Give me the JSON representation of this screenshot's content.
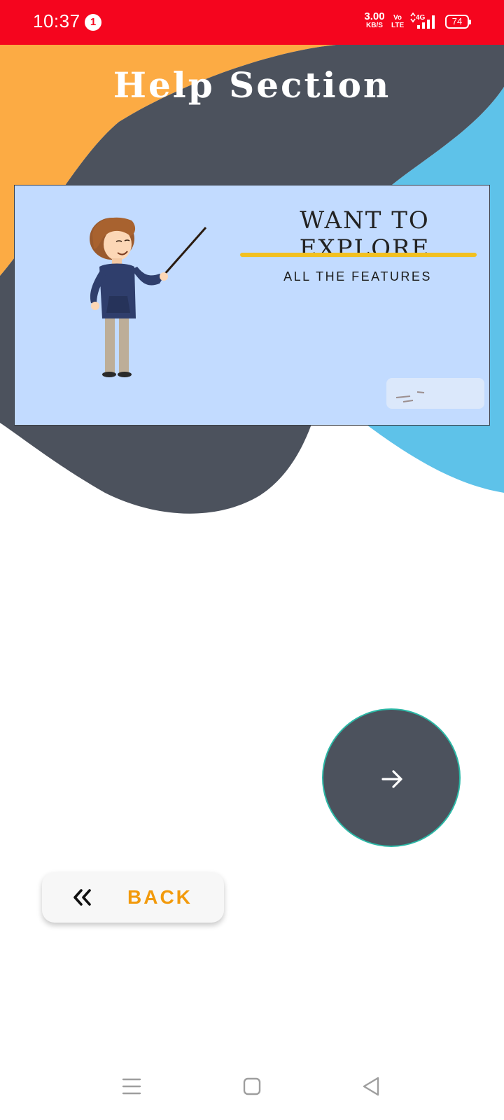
{
  "status_bar": {
    "time": "10:37",
    "notification_count": "1",
    "net_speed_value": "3.00",
    "net_speed_unit": "KB/S",
    "volte_top": "Vo",
    "volte_bottom": "LTE",
    "network_type": "4G",
    "battery_level": "74",
    "background_color": "#f5051e"
  },
  "header": {
    "title": "Help Section"
  },
  "banner": {
    "heading": "WANT TO EXPLORE",
    "subheading": "ALL THE FEATURES",
    "background_color": "#c2dbff",
    "underline_color": "#f2c021"
  },
  "next_button": {
    "icon": "arrow-right-icon",
    "color": "#4c525d"
  },
  "back_button": {
    "icon": "double-chevron-left-icon",
    "label": "BACK",
    "label_color": "#f29a0c"
  },
  "nav_bar": {
    "items": [
      "menu-icon",
      "home-square-icon",
      "back-triangle-icon"
    ]
  },
  "theme": {
    "orange_blob": "#fcab44",
    "dark_blob": "#4c525d",
    "blue_blob": "#5ec2e9"
  }
}
